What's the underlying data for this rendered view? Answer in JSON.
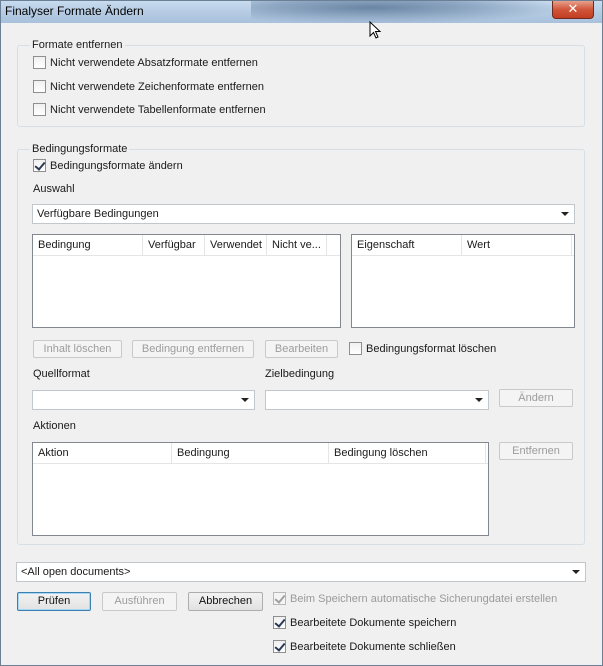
{
  "window": {
    "title": "Finalyser Formate Ändern",
    "close_glyph": "✕"
  },
  "formate_entfernen": {
    "legend": "Formate entfernen",
    "options": [
      {
        "label": "Nicht verwendete Absatzformate entfernen",
        "checked": false
      },
      {
        "label": "Nicht verwendete Zeichenformate entfernen",
        "checked": false
      },
      {
        "label": "Nicht verwendete Tabellenformate entfernen",
        "checked": false
      }
    ]
  },
  "bedingungsformate": {
    "legend": "Bedingungsformate",
    "aendern_label": "Bedingungsformate ändern",
    "aendern_checked": true,
    "auswahl_label": "Auswahl",
    "auswahl_value": "Verfügbare Bedingungen",
    "conditions_columns": [
      "Bedingung",
      "Verfügbar",
      "Verwendet",
      "Nicht ve..."
    ],
    "properties_columns": [
      "Eigenschaft",
      "Wert"
    ],
    "inhalt_loeschen": "Inhalt löschen",
    "bedingung_entfernen": "Bedingung entfernen",
    "bearbeiten": "Bearbeiten",
    "format_loeschen_label": "Bedingungsformat löschen",
    "quellformat_label": "Quellformat",
    "quellformat_value": "",
    "zielbedingung_label": "Zielbedingung",
    "zielbedingung_value": "",
    "aendern_button": "Ändern",
    "aktionen_label": "Aktionen",
    "actions_columns": [
      "Aktion",
      "Bedingung",
      "Bedingung löschen"
    ],
    "entfernen_button": "Entfernen"
  },
  "footer": {
    "documents_value": "<All open documents>",
    "pruefen": "Prüfen",
    "ausfuehren": "Ausführen",
    "abbrechen": "Abbrechen",
    "backup_label": "Beim Speichern automatische Sicherungdatei erstellen",
    "save_label": "Bearbeitete Dokumente speichern",
    "close_label": "Bearbeitete Dokumente schließen"
  }
}
